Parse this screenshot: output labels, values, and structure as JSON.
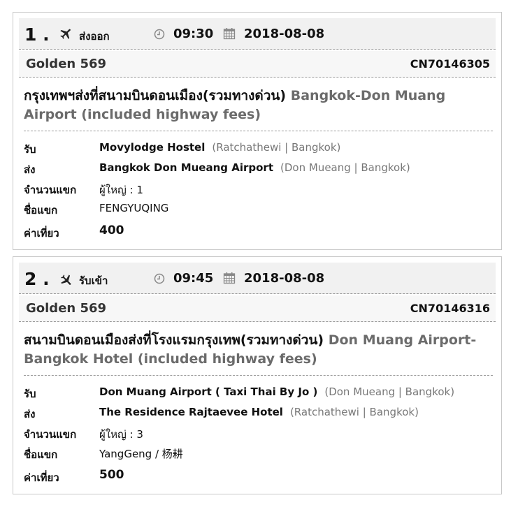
{
  "bookings": [
    {
      "index": "1 .",
      "plane_icon": "plane-departure-icon",
      "direction": "ส่งออก",
      "time": "09:30",
      "date": "2018-08-08",
      "company": "Golden 569",
      "code": "CN70146305",
      "route_th": "กรุงเทพฯส่งที่สนามบินดอนเมือง(รวมทางด่วน)",
      "route_en": "Bangkok-Don Muang Airport (included highway fees)",
      "pickup_label": "รับ",
      "pickup_place": "Movylodge Hostel",
      "pickup_area": "(Ratchathewi | Bangkok)",
      "dropoff_label": "ส่ง",
      "dropoff_place": "Bangkok Don Mueang Airport",
      "dropoff_area": "(Don Mueang | Bangkok)",
      "pax_label": "จำนวนแขก",
      "pax_value": "ผู้ใหญ่ : 1",
      "name_label": "ชื่อแขก",
      "name_value": "FENGYUQING",
      "fare_label": "ค่าเที่ยว",
      "fare_value": "400"
    },
    {
      "index": "2 .",
      "plane_icon": "plane-arrival-icon",
      "direction": "รับเข้า",
      "time": "09:45",
      "date": "2018-08-08",
      "company": "Golden 569",
      "code": "CN70146316",
      "route_th": "สนามบินดอนเมืองส่งที่โรงแรมกรุงเทพ(รวมทางด่วน)",
      "route_en": "Don Muang Airport-Bangkok Hotel (included highway fees)",
      "pickup_label": "รับ",
      "pickup_place": "Don Muang Airport ( Taxi Thai By Jo )",
      "pickup_area": "(Don Mueang | Bangkok)",
      "dropoff_label": "ส่ง",
      "dropoff_place": "The Residence Rajtaevee Hotel",
      "dropoff_area": "(Ratchathewi | Bangkok)",
      "pax_label": "จำนวนแขก",
      "pax_value": "ผู้ใหญ่ : 3",
      "name_label": "ชื่อแขก",
      "name_value": "YangGeng / 杨耕",
      "fare_label": "ค่าเที่ยว",
      "fare_value": "500"
    }
  ]
}
